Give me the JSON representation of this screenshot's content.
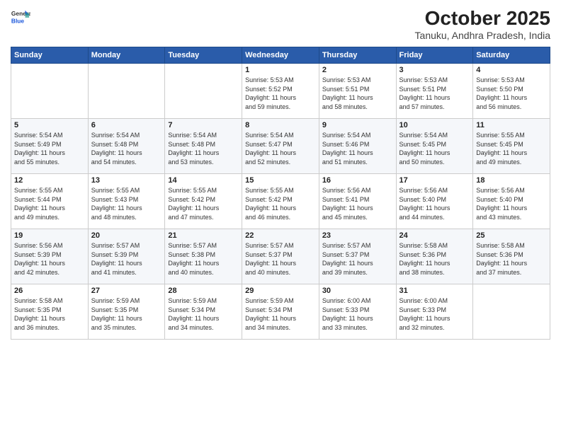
{
  "header": {
    "logo_general": "General",
    "logo_blue": "Blue",
    "month_title": "October 2025",
    "location": "Tanuku, Andhra Pradesh, India"
  },
  "weekdays": [
    "Sunday",
    "Monday",
    "Tuesday",
    "Wednesday",
    "Thursday",
    "Friday",
    "Saturday"
  ],
  "weeks": [
    [
      {
        "day": "",
        "info": ""
      },
      {
        "day": "",
        "info": ""
      },
      {
        "day": "",
        "info": ""
      },
      {
        "day": "1",
        "info": "Sunrise: 5:53 AM\nSunset: 5:52 PM\nDaylight: 11 hours\nand 59 minutes."
      },
      {
        "day": "2",
        "info": "Sunrise: 5:53 AM\nSunset: 5:51 PM\nDaylight: 11 hours\nand 58 minutes."
      },
      {
        "day": "3",
        "info": "Sunrise: 5:53 AM\nSunset: 5:51 PM\nDaylight: 11 hours\nand 57 minutes."
      },
      {
        "day": "4",
        "info": "Sunrise: 5:53 AM\nSunset: 5:50 PM\nDaylight: 11 hours\nand 56 minutes."
      }
    ],
    [
      {
        "day": "5",
        "info": "Sunrise: 5:54 AM\nSunset: 5:49 PM\nDaylight: 11 hours\nand 55 minutes."
      },
      {
        "day": "6",
        "info": "Sunrise: 5:54 AM\nSunset: 5:48 PM\nDaylight: 11 hours\nand 54 minutes."
      },
      {
        "day": "7",
        "info": "Sunrise: 5:54 AM\nSunset: 5:48 PM\nDaylight: 11 hours\nand 53 minutes."
      },
      {
        "day": "8",
        "info": "Sunrise: 5:54 AM\nSunset: 5:47 PM\nDaylight: 11 hours\nand 52 minutes."
      },
      {
        "day": "9",
        "info": "Sunrise: 5:54 AM\nSunset: 5:46 PM\nDaylight: 11 hours\nand 51 minutes."
      },
      {
        "day": "10",
        "info": "Sunrise: 5:54 AM\nSunset: 5:45 PM\nDaylight: 11 hours\nand 50 minutes."
      },
      {
        "day": "11",
        "info": "Sunrise: 5:55 AM\nSunset: 5:45 PM\nDaylight: 11 hours\nand 49 minutes."
      }
    ],
    [
      {
        "day": "12",
        "info": "Sunrise: 5:55 AM\nSunset: 5:44 PM\nDaylight: 11 hours\nand 49 minutes."
      },
      {
        "day": "13",
        "info": "Sunrise: 5:55 AM\nSunset: 5:43 PM\nDaylight: 11 hours\nand 48 minutes."
      },
      {
        "day": "14",
        "info": "Sunrise: 5:55 AM\nSunset: 5:42 PM\nDaylight: 11 hours\nand 47 minutes."
      },
      {
        "day": "15",
        "info": "Sunrise: 5:55 AM\nSunset: 5:42 PM\nDaylight: 11 hours\nand 46 minutes."
      },
      {
        "day": "16",
        "info": "Sunrise: 5:56 AM\nSunset: 5:41 PM\nDaylight: 11 hours\nand 45 minutes."
      },
      {
        "day": "17",
        "info": "Sunrise: 5:56 AM\nSunset: 5:40 PM\nDaylight: 11 hours\nand 44 minutes."
      },
      {
        "day": "18",
        "info": "Sunrise: 5:56 AM\nSunset: 5:40 PM\nDaylight: 11 hours\nand 43 minutes."
      }
    ],
    [
      {
        "day": "19",
        "info": "Sunrise: 5:56 AM\nSunset: 5:39 PM\nDaylight: 11 hours\nand 42 minutes."
      },
      {
        "day": "20",
        "info": "Sunrise: 5:57 AM\nSunset: 5:39 PM\nDaylight: 11 hours\nand 41 minutes."
      },
      {
        "day": "21",
        "info": "Sunrise: 5:57 AM\nSunset: 5:38 PM\nDaylight: 11 hours\nand 40 minutes."
      },
      {
        "day": "22",
        "info": "Sunrise: 5:57 AM\nSunset: 5:37 PM\nDaylight: 11 hours\nand 40 minutes."
      },
      {
        "day": "23",
        "info": "Sunrise: 5:57 AM\nSunset: 5:37 PM\nDaylight: 11 hours\nand 39 minutes."
      },
      {
        "day": "24",
        "info": "Sunrise: 5:58 AM\nSunset: 5:36 PM\nDaylight: 11 hours\nand 38 minutes."
      },
      {
        "day": "25",
        "info": "Sunrise: 5:58 AM\nSunset: 5:36 PM\nDaylight: 11 hours\nand 37 minutes."
      }
    ],
    [
      {
        "day": "26",
        "info": "Sunrise: 5:58 AM\nSunset: 5:35 PM\nDaylight: 11 hours\nand 36 minutes."
      },
      {
        "day": "27",
        "info": "Sunrise: 5:59 AM\nSunset: 5:35 PM\nDaylight: 11 hours\nand 35 minutes."
      },
      {
        "day": "28",
        "info": "Sunrise: 5:59 AM\nSunset: 5:34 PM\nDaylight: 11 hours\nand 34 minutes."
      },
      {
        "day": "29",
        "info": "Sunrise: 5:59 AM\nSunset: 5:34 PM\nDaylight: 11 hours\nand 34 minutes."
      },
      {
        "day": "30",
        "info": "Sunrise: 6:00 AM\nSunset: 5:33 PM\nDaylight: 11 hours\nand 33 minutes."
      },
      {
        "day": "31",
        "info": "Sunrise: 6:00 AM\nSunset: 5:33 PM\nDaylight: 11 hours\nand 32 minutes."
      },
      {
        "day": "",
        "info": ""
      }
    ]
  ]
}
